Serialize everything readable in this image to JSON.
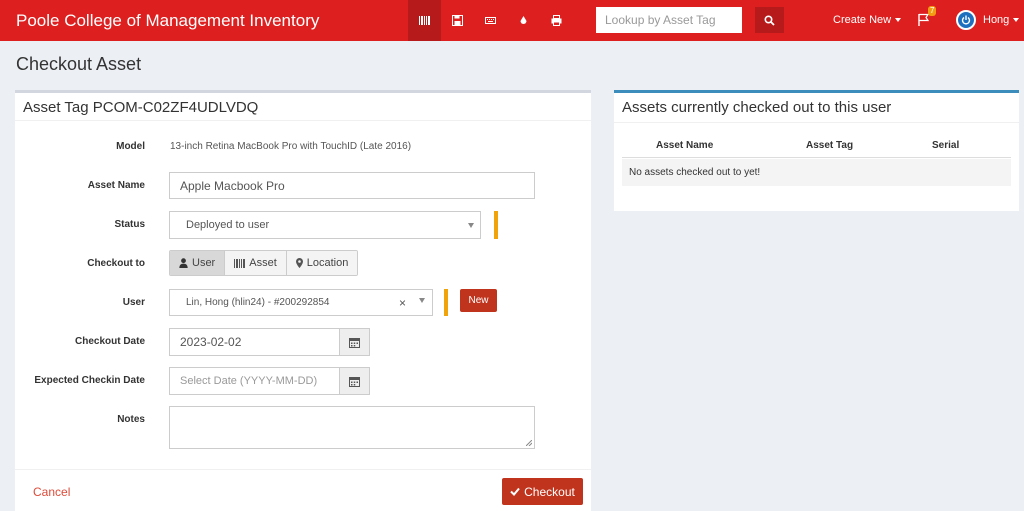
{
  "header": {
    "brand": "Poole College of Management Inventory",
    "nav_icons": [
      "barcode-icon",
      "save-icon",
      "keyboard-icon",
      "tint-icon",
      "print-icon"
    ],
    "search": {
      "placeholder": "Lookup by Asset Tag",
      "value": ""
    },
    "create_new": "Create New",
    "alerts_count": "7",
    "username": "Hong",
    "colors": {
      "bar": "#dd1f1f",
      "active": "#b71a1a"
    }
  },
  "page": {
    "title": "Checkout Asset"
  },
  "form": {
    "title": "Asset Tag PCOM-C02ZF4UDLVDQ",
    "model_label": "Model",
    "model_value": "13-inch Retina MacBook Pro with TouchID (Late 2016)",
    "asset_name_label": "Asset Name",
    "asset_name_value": "Apple Macbook Pro",
    "status_label": "Status",
    "status_value": "Deployed to user",
    "checkout_to_label": "Checkout to",
    "checkout_options": [
      "User",
      "Asset",
      "Location"
    ],
    "checkout_selected": "User",
    "user_label": "User",
    "user_value": "Lin, Hong (hlin24) - #200292854",
    "user_clear": "×",
    "new_button": "New",
    "checkout_date_label": "Checkout Date",
    "checkout_date_value": "2023-02-02",
    "expected_checkin_label": "Expected Checkin Date",
    "expected_checkin_placeholder": "Select Date (YYYY-MM-DD)",
    "notes_label": "Notes",
    "notes_value": "",
    "cancel": "Cancel",
    "checkout_button": "Checkout",
    "colors": {
      "required": "#f0a30a",
      "button": "#c0341d"
    }
  },
  "assets_panel": {
    "title": "Assets currently checked out to this user",
    "columns": [
      "Asset Name",
      "Asset Tag",
      "Serial"
    ],
    "empty_message": "No assets checked out to yet!"
  }
}
